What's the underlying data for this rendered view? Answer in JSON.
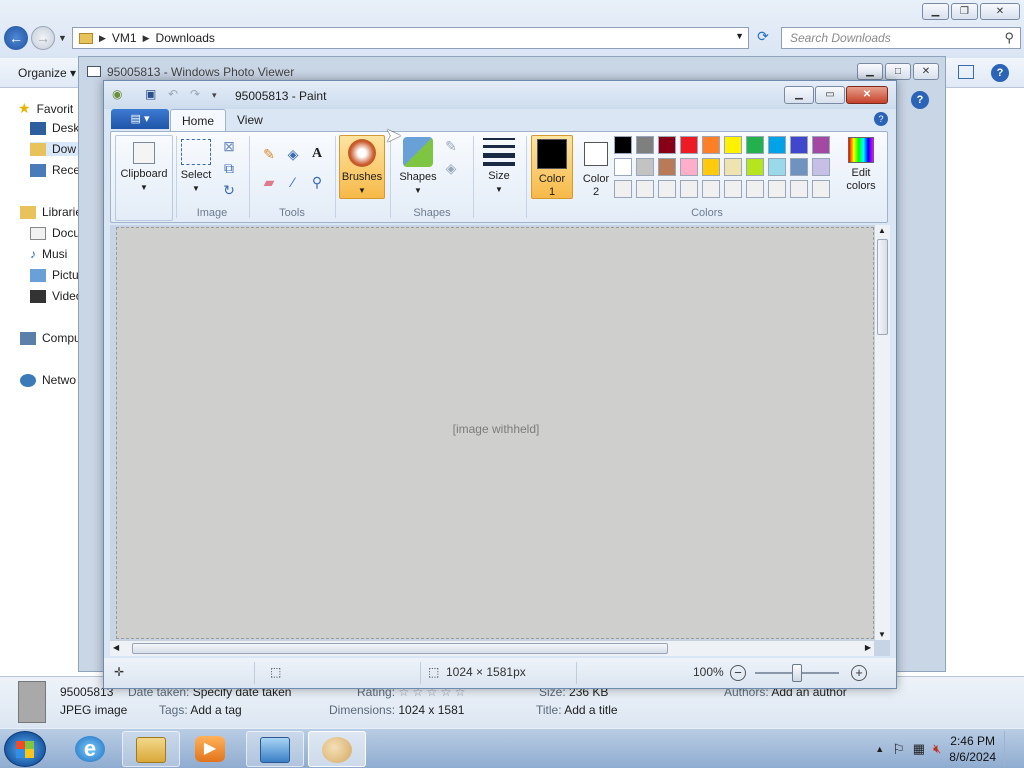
{
  "explorer": {
    "breadcrumb": [
      "VM1",
      "Downloads"
    ],
    "search_placeholder": "Search Downloads",
    "organize_label": "Organize",
    "nav_items": [
      {
        "label": "Favorit",
        "icon": "star-icon"
      },
      {
        "label": "Deskt",
        "icon": "desktop-icon"
      },
      {
        "label": "Dow",
        "icon": "downloads-folder-icon"
      },
      {
        "label": "Rece",
        "icon": "recent-places-icon"
      },
      {
        "label": "Libraries",
        "icon": "libraries-icon"
      },
      {
        "label": "Docu",
        "icon": "documents-icon"
      },
      {
        "label": "Musi",
        "icon": "music-icon"
      },
      {
        "label": "Pictu",
        "icon": "pictures-icon"
      },
      {
        "label": "Video",
        "icon": "videos-icon"
      },
      {
        "label": "Compu",
        "icon": "computer-icon"
      },
      {
        "label": "Netwo",
        "icon": "network-icon"
      }
    ],
    "details": {
      "filename": "95005813",
      "filetype": "JPEG image",
      "date_taken_key": "Date taken:",
      "date_taken_val": "Specify date taken",
      "tags_key": "Tags:",
      "tags_val": "Add a tag",
      "rating_key": "Rating:",
      "rating_stars": "☆ ☆ ☆ ☆ ☆",
      "dimensions_key": "Dimensions:",
      "dimensions_val": "1024 x 1581",
      "size_key": "Size:",
      "size_val": "236 KB",
      "title_key": "Title:",
      "title_val": "Add a title",
      "authors_key": "Authors:",
      "authors_val": "Add an author"
    }
  },
  "photo_viewer": {
    "title": "95005813 - Windows Photo Viewer"
  },
  "paint": {
    "title": "95005813 - Paint",
    "tabs": [
      "Home",
      "View"
    ],
    "groups": {
      "clipboard": "Clipboard",
      "image": "Image",
      "select": "Select",
      "tools": "Tools",
      "brushes": "Brushes",
      "shapes_btn": "Shapes",
      "shapes": "Shapes",
      "size": "Size",
      "color1": "Color\n1",
      "color1_a": "Color",
      "color1_b": "1",
      "color2_a": "Color",
      "color2_b": "2",
      "colors": "Colors",
      "edit_colors_a": "Edit",
      "edit_colors_b": "colors"
    },
    "color1": "#000000",
    "color2": "#ffffff",
    "palette": [
      "#000000",
      "#7f7f7f",
      "#880015",
      "#ed1c24",
      "#ff7f27",
      "#fff200",
      "#22b14c",
      "#00a2e8",
      "#3f48cc",
      "#a349a4",
      "#ffffff",
      "#c3c3c3",
      "#b97a57",
      "#ffaec9",
      "#ffc90e",
      "#efe4b0",
      "#b5e61d",
      "#99d9ea",
      "#7092be",
      "#c8bfe7",
      "#f0f0f0",
      "#f0f0f0",
      "#f0f0f0",
      "#f0f0f0",
      "#f0f0f0",
      "#f0f0f0",
      "#f0f0f0",
      "#f0f0f0",
      "#f0f0f0",
      "#f0f0f0"
    ],
    "canvas_placeholder": "[image withheld]",
    "status": {
      "dimensions": "1024 × 1581px",
      "zoom": "100%"
    }
  },
  "taskbar": {
    "time": "2:46 PM",
    "date": "8/6/2024"
  }
}
